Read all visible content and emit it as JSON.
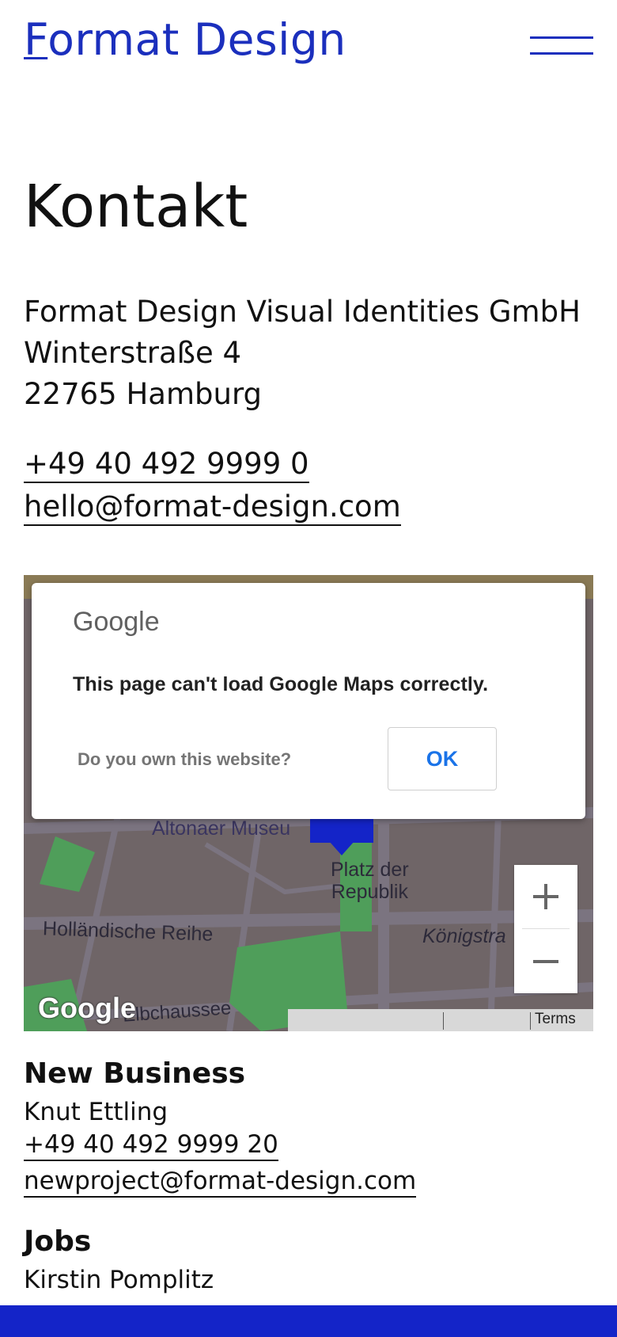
{
  "header": {
    "logo_first": "F",
    "logo_rest": "ormat Design"
  },
  "page": {
    "title": "Kontakt"
  },
  "address": {
    "company": "Format Design Visual Identities GmbH",
    "street": "Winterstraße 4",
    "city": "22765 Hamburg"
  },
  "contact": {
    "phone": "+49 40 492 9999 0",
    "email": "hello@format-design.com"
  },
  "map": {
    "labels": {
      "altonaer": "Altonaer Museu",
      "platz": "Platz der",
      "platz2": "Republik",
      "hollaendische": "Holländische Reihe",
      "koenig": "Königstra",
      "elb": "Elbchaussee"
    },
    "google_logo": "Google",
    "terms": "Terms",
    "dialog": {
      "brand": "Google",
      "message": "This page can't load Google Maps correctly.",
      "own_link": "Do you own this website?",
      "ok_label": "OK"
    },
    "colors": {
      "map_base": "#6f6567",
      "park": "#4f9e5a",
      "marker": "#1424c8"
    }
  },
  "new_business": {
    "heading": "New Business",
    "name": "Knut Ettling",
    "phone": "+49 40 492 9999 20",
    "email": "newproject@format-design.com"
  },
  "jobs": {
    "heading": "Jobs",
    "name": "Kirstin Pomplitz"
  },
  "colors": {
    "brand": "#1b2fbd",
    "footer": "#1424c8"
  }
}
